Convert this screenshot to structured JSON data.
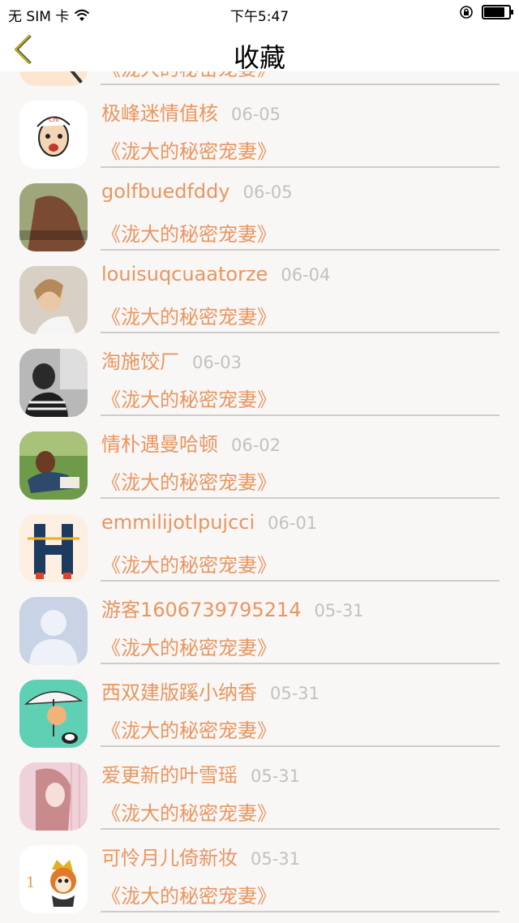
{
  "status_bar": {
    "carrier": "无 SIM 卡",
    "time": "下午5:47",
    "icons": [
      "wifi-icon",
      "orientation-lock-icon",
      "battery-icon"
    ],
    "battery_level": 0.85
  },
  "nav": {
    "title": "收藏",
    "back_icon": "chevron-left-icon"
  },
  "colors": {
    "accent": "#e8965f",
    "date": "#c4c0c0",
    "background": "#f9f6f6",
    "back_chevron": "#b1a92f"
  },
  "items": [
    {
      "name": "",
      "date": "",
      "book": "《泷大的秘密宠妻》",
      "avatar": "partial-avatar"
    },
    {
      "name": "极峰迷情值核",
      "date": "06-05",
      "book": "《泷大的秘密宠妻》",
      "avatar": "cartoon-face-avatar"
    },
    {
      "name": "golfbuedfddy",
      "date": "06-05",
      "book": "《泷大的秘密宠妻》",
      "avatar": "photo-avatar"
    },
    {
      "name": "louisuqcuaatorze",
      "date": "06-04",
      "book": "《泷大的秘密宠妻》",
      "avatar": "photo-avatar"
    },
    {
      "name": "淘施饺厂",
      "date": "06-03",
      "book": "《泷大的秘密宠妻》",
      "avatar": "photo-avatar"
    },
    {
      "name": "情朴遇曼哈顿",
      "date": "06-02",
      "book": "《泷大的秘密宠妻》",
      "avatar": "photo-avatar"
    },
    {
      "name": "emmilijotlpujcci",
      "date": "06-01",
      "book": "《泷大的秘密宠妻》",
      "avatar": "letter-h-avatar"
    },
    {
      "name": "游客1606739795214",
      "date": "05-31",
      "book": "《泷大的秘密宠妻》",
      "avatar": "default-user-avatar"
    },
    {
      "name": "西双建版蹊小纳香",
      "date": "05-31",
      "book": "《泷大的秘密宠妻》",
      "avatar": "cartoon-umbrella-avatar"
    },
    {
      "name": "爱更新的叶雪瑶",
      "date": "05-31",
      "book": "《泷大的秘密宠妻》",
      "avatar": "illustration-avatar"
    },
    {
      "name": "可怜月儿倚新妆",
      "date": "05-31",
      "book": "《泷大的秘密宠妻》",
      "avatar": "cartoon-fox-avatar"
    }
  ]
}
